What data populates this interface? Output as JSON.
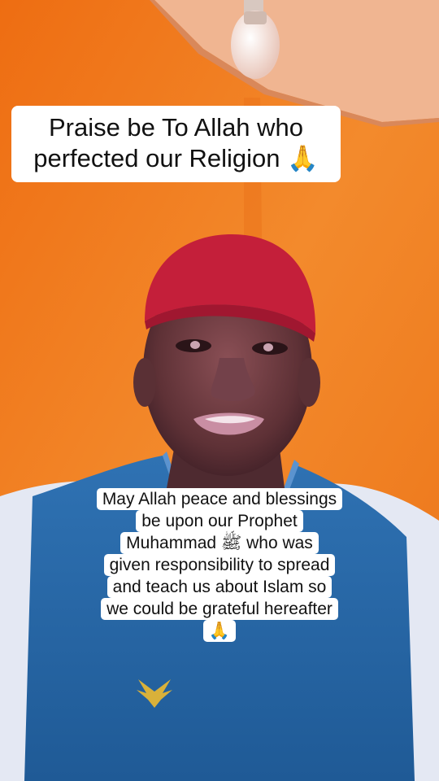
{
  "top_caption": {
    "line1": "Praise be To Allah who",
    "line2": "perfected our Religion 🙏"
  },
  "bottom_caption": {
    "lines": [
      "May Allah peace and blessings",
      "be upon our Prophet",
      "Muhammad ﷺ who was",
      "given responsibility to spread",
      "and teach us about Islam so",
      "we could be grateful hereafter",
      "🙏"
    ]
  },
  "colors": {
    "wall": "#f07c22",
    "cap": "#c4203a",
    "vest": "#2d6fb0",
    "shirt": "#e8ecf5",
    "skin": "#6a3a3c"
  }
}
